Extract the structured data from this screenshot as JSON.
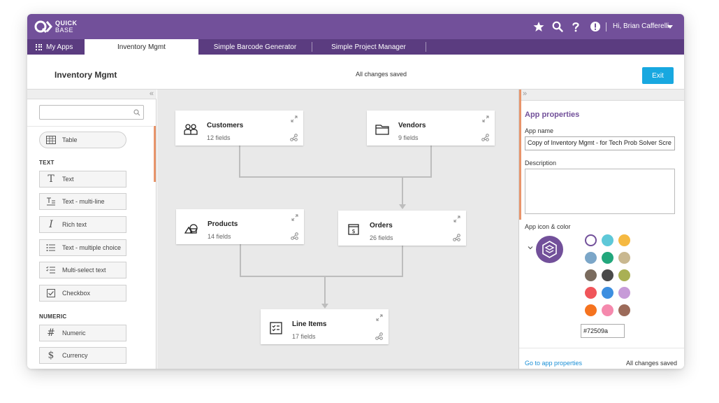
{
  "brand": {
    "line1": "QUICK",
    "line2": "BASE"
  },
  "topbar": {
    "icons": [
      "star-icon",
      "search-icon",
      "help-icon",
      "alert-icon"
    ],
    "user_label": "Hi, Brian Cafferelli"
  },
  "tabs": {
    "my_apps": "My Apps",
    "items": [
      {
        "label": "Inventory Mgmt",
        "active": true
      },
      {
        "label": "Simple Barcode Generator",
        "active": false
      },
      {
        "label": "Simple Project Manager",
        "active": false
      }
    ]
  },
  "header": {
    "app_title": "Inventory Mgmt",
    "save_status": "All changes saved",
    "exit_label": "Exit"
  },
  "left_panel": {
    "collapse_glyph": "«",
    "search_placeholder": "",
    "table_item": {
      "label": "Table",
      "icon": "table-icon"
    },
    "sections": [
      {
        "title": "TEXT",
        "items": [
          {
            "label": "Text",
            "icon": "text-icon"
          },
          {
            "label": "Text - multi-line",
            "icon": "multiline-icon"
          },
          {
            "label": "Rich text",
            "icon": "italic-icon"
          },
          {
            "label": "Text - multiple choice",
            "icon": "list-icon"
          },
          {
            "label": "Multi-select text",
            "icon": "checklist-icon"
          },
          {
            "label": "Checkbox",
            "icon": "checkbox-icon"
          }
        ]
      },
      {
        "title": "NUMERIC",
        "items": [
          {
            "label": "Numeric",
            "icon": "hash-icon"
          },
          {
            "label": "Currency",
            "icon": "dollar-icon"
          }
        ]
      }
    ]
  },
  "canvas": {
    "tables": [
      {
        "name": "Customers",
        "fields": "12 fields",
        "icon": "people-icon"
      },
      {
        "name": "Vendors",
        "fields": "9 fields",
        "icon": "folder-icon"
      },
      {
        "name": "Products",
        "fields": "14 fields",
        "icon": "shapes-icon"
      },
      {
        "name": "Orders",
        "fields": "26 fields",
        "icon": "invoice-icon"
      },
      {
        "name": "Line Items",
        "fields": "17 fields",
        "icon": "checklist-icon"
      }
    ]
  },
  "right_panel": {
    "collapse_glyph": "»",
    "title": "App properties",
    "app_name_label": "App name",
    "app_name_value": "Copy of Inventory Mgmt - for Tech Prob Solver Scre",
    "description_label": "Description",
    "description_value": "",
    "icon_color_label": "App icon & color",
    "swatches": [
      "#ffffff",
      "#5ec8d8",
      "#f5b942",
      "#7ba6c8",
      "#22a77c",
      "#c9b890",
      "#7a6b5e",
      "#4a4a4a",
      "#a9b054",
      "#f0555a",
      "#3d8fe0",
      "#c79bd8",
      "#f5731f",
      "#f589ad",
      "#9c6b5a"
    ],
    "selected_color": "#72509a",
    "hex_value": "#72509a",
    "goto_link": "Go to app properties",
    "status": "All changes saved"
  }
}
